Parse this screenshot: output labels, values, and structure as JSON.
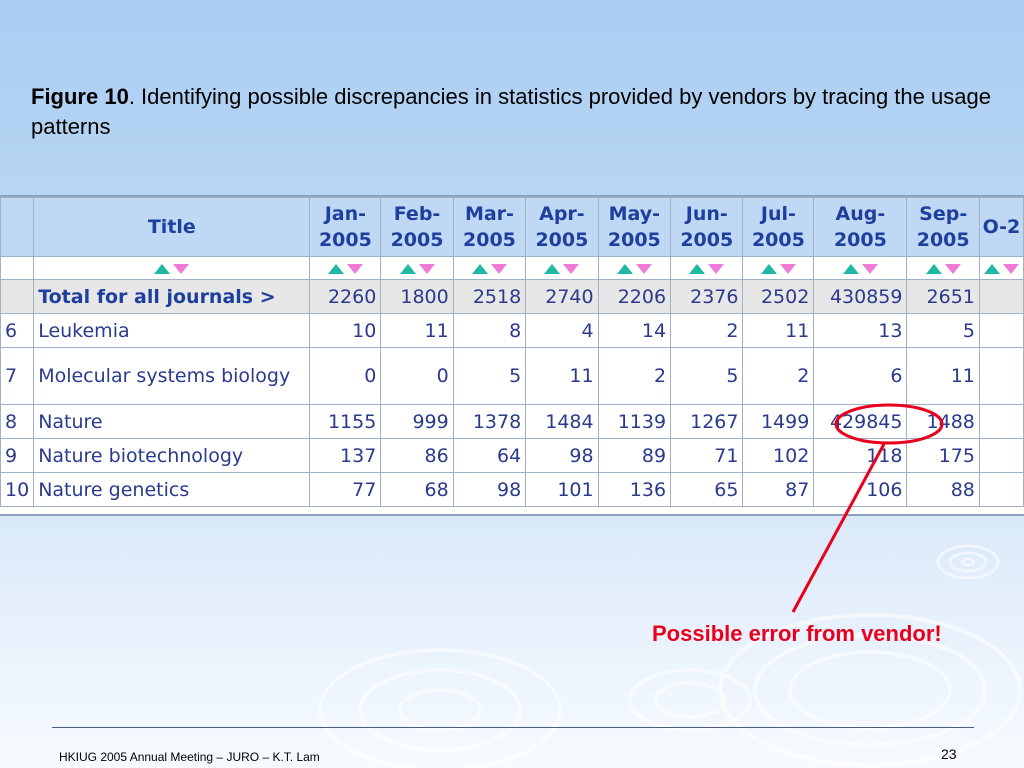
{
  "caption": {
    "bold": "Figure 10",
    "text": ". Identifying possible discrepancies in statistics provided by vendors by tracing the usage patterns"
  },
  "table": {
    "title_header": "Title",
    "total_label": "Total for all journals >",
    "months": [
      "Jan-2005",
      "Feb-2005",
      "Mar-2005",
      "Apr-2005",
      "May-2005",
      "Jun-2005",
      "Jul-2005",
      "Aug-2005",
      "Sep-2005",
      "O-2"
    ],
    "totals": [
      "2260",
      "1800",
      "2518",
      "2740",
      "2206",
      "2376",
      "2502",
      "430859",
      "2651",
      ""
    ],
    "rows": [
      {
        "index": "6",
        "title": "Leukemia",
        "values": [
          "10",
          "11",
          "8",
          "4",
          "14",
          "2",
          "11",
          "13",
          "5",
          ""
        ]
      },
      {
        "index": "7",
        "title": "Molecular systems biology",
        "values": [
          "0",
          "0",
          "5",
          "11",
          "2",
          "5",
          "2",
          "6",
          "11",
          ""
        ]
      },
      {
        "index": "8",
        "title": "Nature",
        "values": [
          "1155",
          "999",
          "1378",
          "1484",
          "1139",
          "1267",
          "1499",
          "429845",
          "1488",
          ""
        ]
      },
      {
        "index": "9",
        "title": "Nature biotechnology",
        "values": [
          "137",
          "86",
          "64",
          "98",
          "89",
          "71",
          "102",
          "118",
          "175",
          ""
        ]
      },
      {
        "index": "10",
        "title": "Nature genetics",
        "values": [
          "77",
          "68",
          "98",
          "101",
          "136",
          "65",
          "87",
          "106",
          "88",
          ""
        ]
      }
    ]
  },
  "callout": {
    "text": "Possible error from vendor!",
    "color": "#e8001d"
  },
  "footer": {
    "left": "HKIUG 2005 Annual Meeting – JURO – K.T. Lam",
    "page": "23"
  },
  "colors": {
    "header_bg": "#bfd8f4",
    "accent_up": "#1fb8a4",
    "accent_down": "#f07ad8"
  }
}
